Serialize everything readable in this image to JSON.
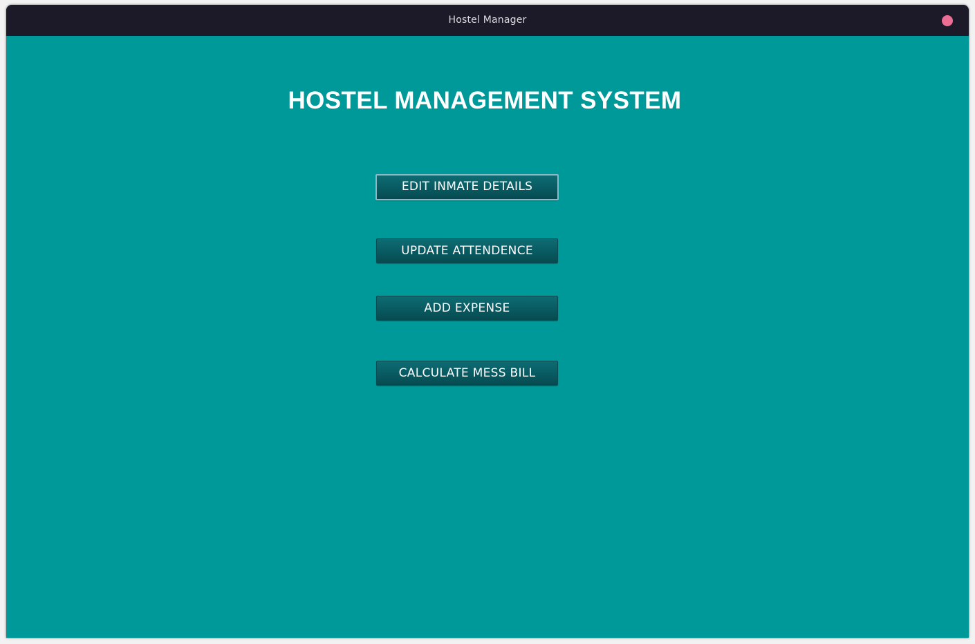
{
  "window": {
    "title": "Hostel Manager"
  },
  "main": {
    "heading": "HOSTEL MANAGEMENT SYSTEM",
    "buttons": {
      "edit_inmate": "EDIT INMATE DETAILS",
      "update_attendance": "UPDATE ATTENDENCE",
      "add_expense": "ADD EXPENSE",
      "calculate_mess_bill": "CALCULATE MESS BILL"
    }
  },
  "colors": {
    "background": "#009999",
    "titlebar": "#1c1a29",
    "button": "#095a61",
    "close_button": "#ec6e95"
  }
}
